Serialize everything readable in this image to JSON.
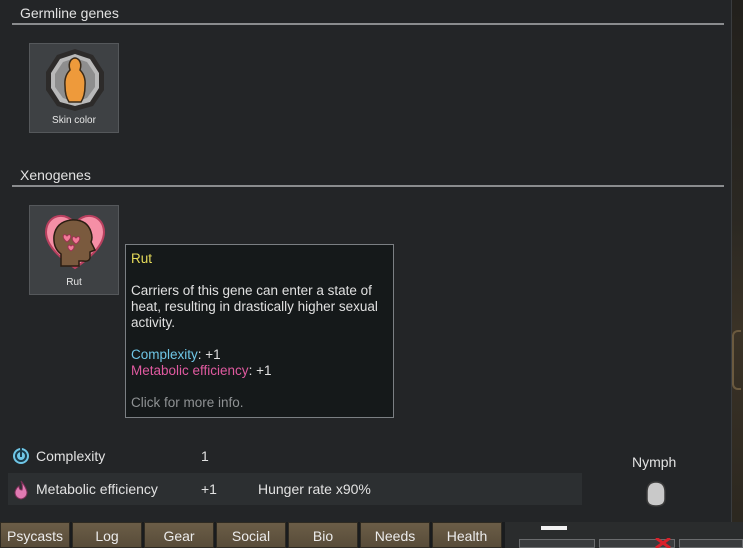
{
  "sections": {
    "germline_title": "Germline genes",
    "xeno_title": "Xenogenes"
  },
  "germline_genes": [
    {
      "label": "Skin color",
      "icon": "skin-color-icon"
    }
  ],
  "xenogenes": [
    {
      "label": "Rut",
      "icon": "rut-heart-head-icon"
    }
  ],
  "tooltip": {
    "title": "Rut",
    "description": "Carriers of this gene can enter a state of heat, resulting in drastically higher sexual activity.",
    "complexity_label": "Complexity",
    "complexity_value": ": +1",
    "metabolic_label": "Metabolic efficiency",
    "metabolic_value": ": +1",
    "hint": "Click for more info."
  },
  "stats": [
    {
      "label": "Complexity",
      "value": "1",
      "extra": "",
      "icon": "complexity-icon"
    },
    {
      "label": "Metabolic efficiency",
      "value": "+1",
      "extra": "Hunger rate x90%",
      "icon": "metabolism-icon"
    }
  ],
  "xenotype": {
    "name": "Nymph",
    "icon": "xenotype-icon"
  },
  "tabs": [
    "Psycasts",
    "Log",
    "Gear",
    "Social",
    "Bio",
    "Needs",
    "Health"
  ],
  "colors": {
    "tooltip_title": "#e6dc5a",
    "complexity": "#6fc6e6",
    "metabolic": "#e05aa0"
  }
}
